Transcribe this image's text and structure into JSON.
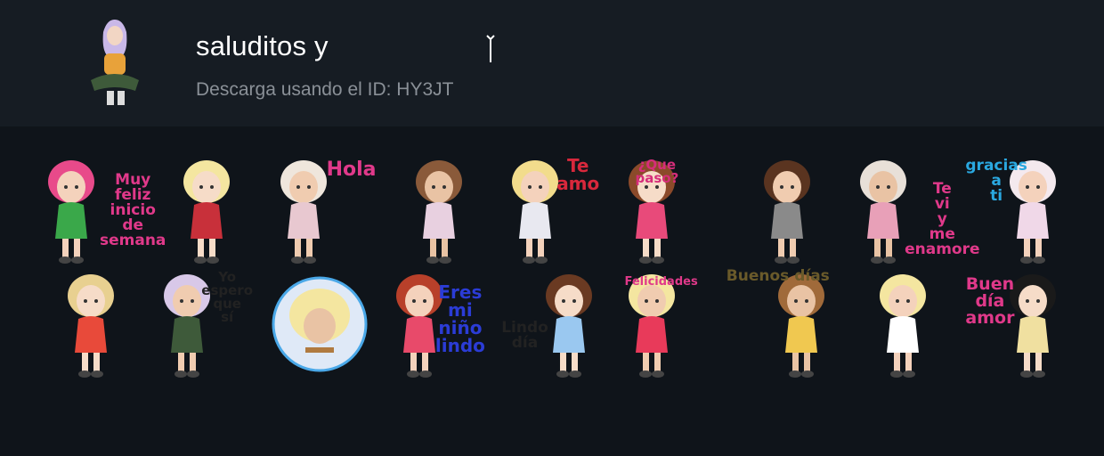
{
  "pack": {
    "title": "saluditos y",
    "subtitle": "Descarga usando el ID: HY3JT"
  },
  "stickers": [
    {
      "lines": [
        "Muy",
        "feliz",
        "inicio",
        "de",
        "semana"
      ],
      "color": "#e0398a"
    },
    {
      "lines": [],
      "color": "#d33"
    },
    {
      "lines": [
        "Hola"
      ],
      "color": "#e0398a"
    },
    {
      "lines": [],
      "color": "#b07060"
    },
    {
      "lines": [
        "Te",
        "amo"
      ],
      "color": "#d8283c"
    },
    {
      "lines": [
        "¿Que",
        "paso?"
      ],
      "color": "#d62d7a"
    },
    {
      "lines": [],
      "color": "#6b4a35"
    },
    {
      "lines": [
        "Te",
        "vi",
        "y",
        "me",
        "enamore"
      ],
      "color": "#e0398a"
    },
    {
      "lines": [
        "gracias",
        "a",
        "ti"
      ],
      "color": "#2aa8e0"
    },
    {
      "lines": [],
      "color": "#e86a3a"
    },
    {
      "lines": [
        "Yo",
        "espero",
        "que",
        "sí"
      ],
      "color": "#222222"
    },
    {
      "lines": [],
      "color": "#4aa8e8"
    },
    {
      "lines": [
        "Eres",
        "mi",
        "niño",
        "lindo"
      ],
      "color": "#2b3cd6"
    },
    {
      "lines": [
        "Lindo",
        "día"
      ],
      "color": "#222222"
    },
    {
      "lines": [
        "Felicidades"
      ],
      "color": "#e0398a"
    },
    {
      "lines": [
        "Buenos días"
      ],
      "color": "#6a5a2a"
    },
    {
      "lines": [],
      "color": "#e03040"
    },
    {
      "lines": [
        "Buen",
        "día",
        "amor"
      ],
      "color": "#e0398a"
    }
  ]
}
